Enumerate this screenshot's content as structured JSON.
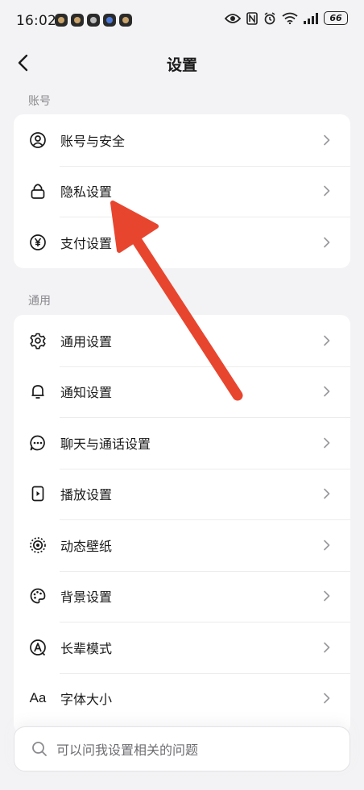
{
  "status": {
    "time": "16:02",
    "battery": "66"
  },
  "header": {
    "title": "设置"
  },
  "sections": [
    {
      "label": "账号",
      "items": [
        {
          "label": "账号与安全",
          "icon": "user-circle-icon"
        },
        {
          "label": "隐私设置",
          "icon": "lock-icon"
        },
        {
          "label": "支付设置",
          "icon": "yen-icon"
        }
      ]
    },
    {
      "label": "通用",
      "items": [
        {
          "label": "通用设置",
          "icon": "gear-icon"
        },
        {
          "label": "通知设置",
          "icon": "bell-icon"
        },
        {
          "label": "聊天与通话设置",
          "icon": "chat-bubble-icon"
        },
        {
          "label": "播放设置",
          "icon": "play-device-icon"
        },
        {
          "label": "动态壁纸",
          "icon": "dynamic-wallpaper-icon"
        },
        {
          "label": "背景设置",
          "icon": "palette-icon"
        },
        {
          "label": "长辈模式",
          "icon": "elder-mode-icon"
        },
        {
          "label": "字体大小",
          "icon": "font-size-icon",
          "glyph": "Aa"
        }
      ]
    }
  ],
  "search": {
    "placeholder": "可以问我设置相关的问题"
  },
  "colors": {
    "annotation_arrow": "#e8452f",
    "background": "#f3f3f5"
  }
}
